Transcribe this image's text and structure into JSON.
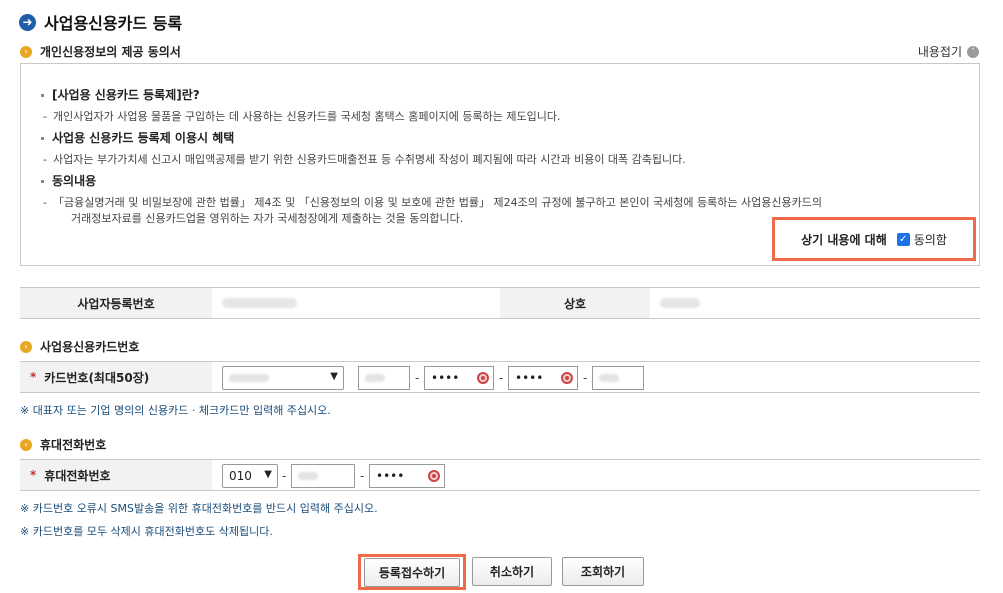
{
  "header": {
    "title": "사업용신용카드 등록"
  },
  "consent": {
    "section_title": "개인신용정보의 제공 동의서",
    "collapse_label": "내용접기",
    "items": [
      {
        "title": "[사업용 신용카드 등록제]란?",
        "desc": "개인사업자가 사업용 물품을 구입하는 데 사용하는 신용카드를 국세청 홈택스 홈페이지에 등록하는 제도입니다."
      },
      {
        "title": "사업용 신용카드 등록제 이용시 혜택",
        "desc": "사업자는 부가가치세 신고시 매입액공제를 받기 위한 신용카드매출전표 등 수취명세 작성이 폐지됨에 따라 시간과 비용이 대폭 감축됩니다."
      },
      {
        "title": "동의내용",
        "desc": "「금융실명거래 및 비밀보장에 관한 법률」 제4조 및 「신용정보의 이용 및 보호에 관한 법률」 제24조의 규정에 불구하고 본인이 국세청에 등록하는 사업용신용카드의",
        "desc2": "거래정보자료를 신용카드업을 영위하는 자가 국세청장에게 제출하는 것을 동의합니다."
      }
    ],
    "agree_label": "상기 내용에 대해",
    "agree_checkbox_label": "동의함",
    "agree_checked": true
  },
  "business": {
    "reg_no_label": "사업자등록번호",
    "name_label": "상호"
  },
  "card": {
    "section_title": "사업용신용카드번호",
    "field_label": "카드번호(최대50장)",
    "masked_1": "••••",
    "masked_2": "••••",
    "separator": "-",
    "note": "※ 대표자 또는 기업 명의의 신용카드 · 체크카드만 입력해 주십시오."
  },
  "phone": {
    "section_title": "휴대전화번호",
    "field_label": "휴대전화번호",
    "prefix": "010",
    "masked": "••••",
    "separator": "-",
    "note_1": "※ 카드번호 오류시 SMS발송을 위한 휴대전화번호를 반드시 입력해 주십시오.",
    "note_2": "※ 카드번호를 모두 삭제시 휴대전화번호도 삭제됩니다."
  },
  "buttons": {
    "submit": "등록접수하기",
    "cancel": "취소하기",
    "inquiry": "조회하기"
  },
  "colors": {
    "accent": "#1f5ea8",
    "bullet": "#e9a620",
    "highlight": "#ef6a4a",
    "checkbox": "#1a73e8"
  },
  "icons": {
    "title": "arrow-right-circle-icon",
    "section": "chevron-right-circle-icon",
    "collapse": "chevron-up-circle-icon",
    "visibility": "eye-toggle-icon"
  }
}
